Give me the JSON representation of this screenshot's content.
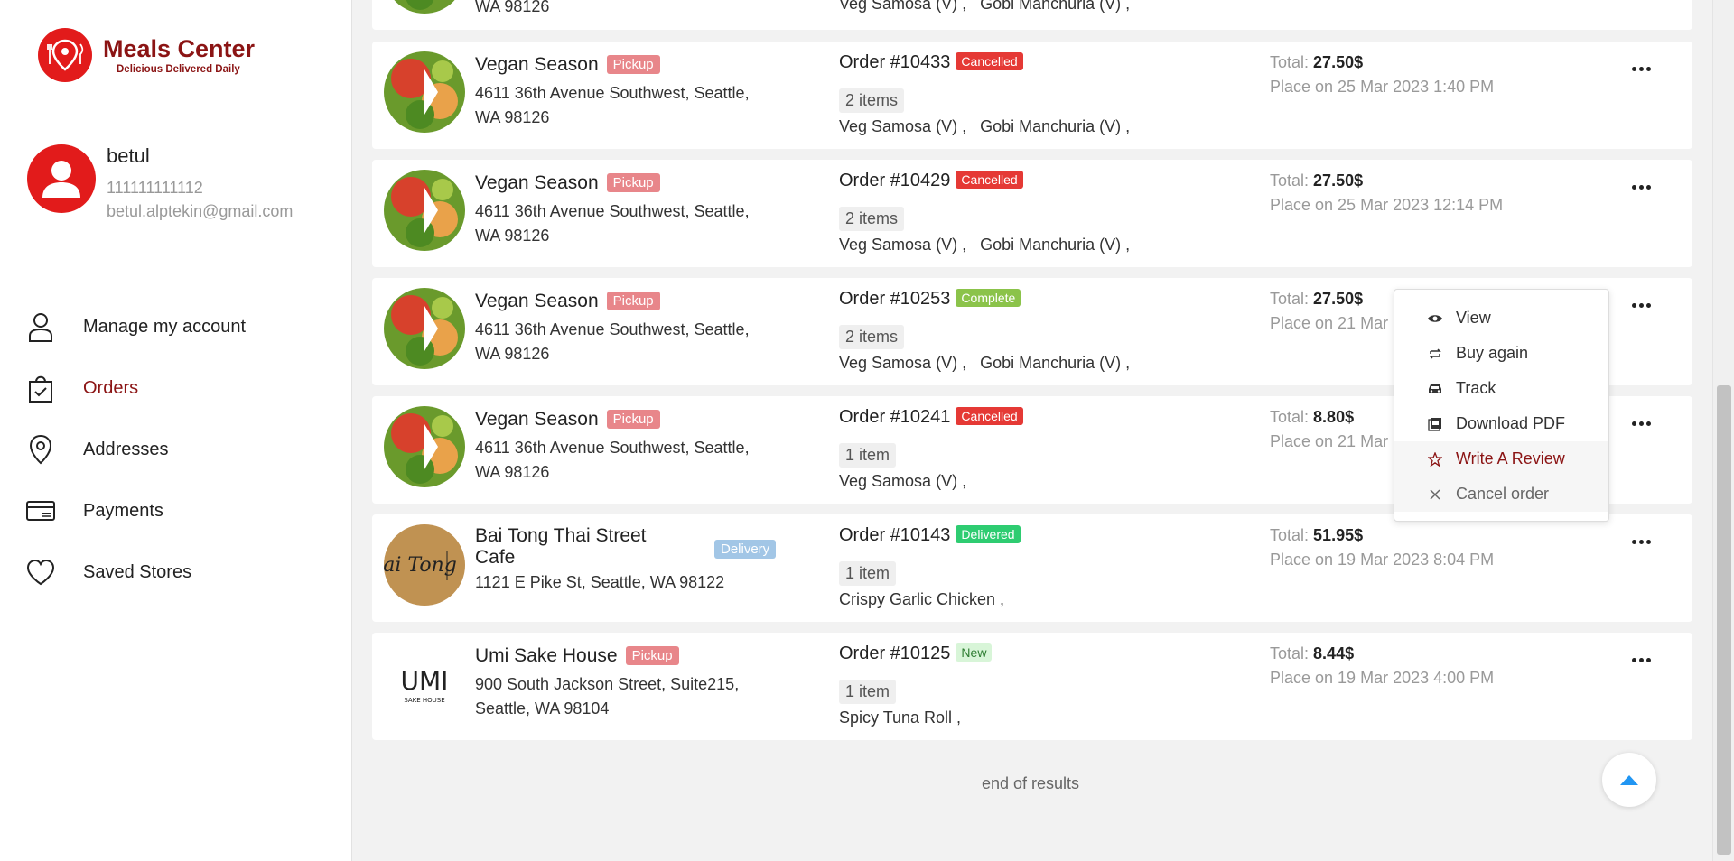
{
  "brand": {
    "name": "Meals Center",
    "tagline": "Delicious Delivered Daily",
    "color": "#e21b1b"
  },
  "profile": {
    "name": "betul",
    "phone": "111111111112",
    "email": "betul.alptekin@gmail.com"
  },
  "nav": [
    {
      "label": "Manage my account",
      "icon": "user-icon"
    },
    {
      "label": "Orders",
      "icon": "shopping-bag-icon",
      "active": true
    },
    {
      "label": "Addresses",
      "icon": "map-pin-icon"
    },
    {
      "label": "Payments",
      "icon": "credit-card-icon"
    },
    {
      "label": "Saved Stores",
      "icon": "heart-icon"
    }
  ],
  "top_partial": {
    "address_tail": "WA 98126",
    "dishes": "Veg Samosa (V) ,   Gobi Manchuria (V) ,"
  },
  "orders": [
    {
      "store": "Vegan Season",
      "mode": "Pickup",
      "address": "4611 36th Avenue Southwest, Seattle, WA 98126",
      "order_no": "Order #10433",
      "status": "Cancelled",
      "items": "2 items",
      "dishes": "Veg Samosa (V) ,   Gobi Manchuria (V) ,",
      "total_label": "Total:",
      "total": "27.50$",
      "placed": "Place on 25 Mar 2023 1:40 PM"
    },
    {
      "store": "Vegan Season",
      "mode": "Pickup",
      "address": "4611 36th Avenue Southwest, Seattle, WA 98126",
      "order_no": "Order #10429",
      "status": "Cancelled",
      "items": "2 items",
      "dishes": "Veg Samosa (V) ,   Gobi Manchuria (V) ,",
      "total_label": "Total:",
      "total": "27.50$",
      "placed": "Place on 25 Mar 2023 12:14 PM"
    },
    {
      "store": "Vegan Season",
      "mode": "Pickup",
      "address": "4611 36th Avenue Southwest, Seattle, WA 98126",
      "order_no": "Order #10253",
      "status": "Complete",
      "items": "2 items",
      "dishes": "Veg Samosa (V) ,   Gobi Manchuria (V) ,",
      "total_label": "Total:",
      "total": "27.50$",
      "placed": "Place on 21 Mar"
    },
    {
      "store": "Vegan Season",
      "mode": "Pickup",
      "address": "4611 36th Avenue Southwest, Seattle, WA 98126",
      "order_no": "Order #10241",
      "status": "Cancelled",
      "items": "1 item",
      "dishes": "Veg Samosa (V) ,",
      "total_label": "Total:",
      "total": "8.80$",
      "placed": "Place on 21 Mar"
    },
    {
      "store": "Bai Tong Thai Street Cafe",
      "mode": "Delivery",
      "address": "1121 E Pike St, Seattle, WA 98122",
      "order_no": "Order #10143",
      "status": "Delivered",
      "items": "1 item",
      "dishes": "Crispy Garlic Chicken ,",
      "total_label": "Total:",
      "total": "51.95$",
      "placed": "Place on 19 Mar 2023 8:04 PM"
    },
    {
      "store": "Umi Sake House",
      "mode": "Pickup",
      "address": "900 South Jackson Street, Suite215, Seattle, WA 98104",
      "order_no": "Order #10125",
      "status": "New",
      "items": "1 item",
      "dishes": "Spicy Tuna Roll ,",
      "total_label": "Total:",
      "total": "8.44$",
      "placed": "Place on 19 Mar 2023 4:00 PM"
    }
  ],
  "status_colors": {
    "Cancelled": "#e53935",
    "Complete": "#8bc34a",
    "Delivered": "#2ecc71",
    "New": "#d8f5d8"
  },
  "logos": {
    "bai_tong": "ai Tong",
    "umi": "UMI",
    "umi_sub": "SAKE HOUSE"
  },
  "dropdown": [
    {
      "label": "View",
      "icon": "eye-icon"
    },
    {
      "label": "Buy again",
      "icon": "repeat-icon"
    },
    {
      "label": "Track",
      "icon": "car-icon"
    },
    {
      "label": "Download PDF",
      "icon": "pdf-icon"
    },
    {
      "label": "Write A Review",
      "icon": "star-icon"
    },
    {
      "label": "Cancel order",
      "icon": "close-icon"
    }
  ],
  "footer": {
    "end_text": "end of results"
  }
}
